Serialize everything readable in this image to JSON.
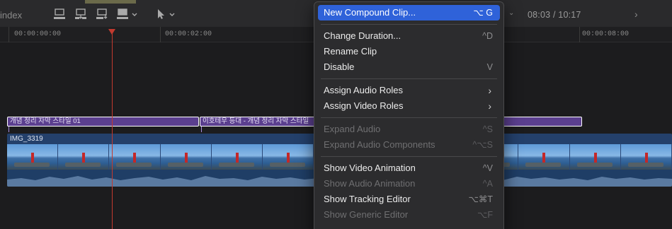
{
  "toolbar": {
    "index_label": "index",
    "timecode": "08:03 / 10:17",
    "icons": [
      "connect-clip-icon",
      "insert-clip-icon",
      "append-clip-icon",
      "overwrite-clip-icon",
      "select-tool-icon",
      "chevron-right-icon"
    ]
  },
  "ruler": {
    "labels": [
      "00:00:00:00",
      "00:00:02:00",
      "00:00:08:00"
    ]
  },
  "timeline": {
    "title_clip_1": "개념 정리 자막 스타일 01",
    "title_clip_2": "이호테우 등대 - 개념 정리 자막 스타일",
    "video_clip_label": "IMG_3319"
  },
  "menu": {
    "items": [
      {
        "label": "New Compound Clip...",
        "shortcut": "⌥ G"
      },
      {
        "label": "Change Duration...",
        "shortcut": "^D"
      },
      {
        "label": "Rename Clip",
        "shortcut": ""
      },
      {
        "label": "Disable",
        "shortcut": "V"
      },
      {
        "label": "Assign Audio Roles",
        "shortcut": ""
      },
      {
        "label": "Assign Video Roles",
        "shortcut": ""
      },
      {
        "label": "Expand Audio",
        "shortcut": "^S"
      },
      {
        "label": "Expand Audio Components",
        "shortcut": "^⌥S"
      },
      {
        "label": "Show Video Animation",
        "shortcut": "^V"
      },
      {
        "label": "Show Audio Animation",
        "shortcut": "^A"
      },
      {
        "label": "Show Tracking Editor",
        "shortcut": "⌥⌘T"
      },
      {
        "label": "Show Generic Editor",
        "shortcut": "⌥F"
      }
    ],
    "submenu_glyph": "›"
  },
  "colors": {
    "menu_highlight": "#2f62d9",
    "playhead": "#c23a2f",
    "title_clip": "#5b3f8f",
    "video_clip": "#24406b"
  }
}
